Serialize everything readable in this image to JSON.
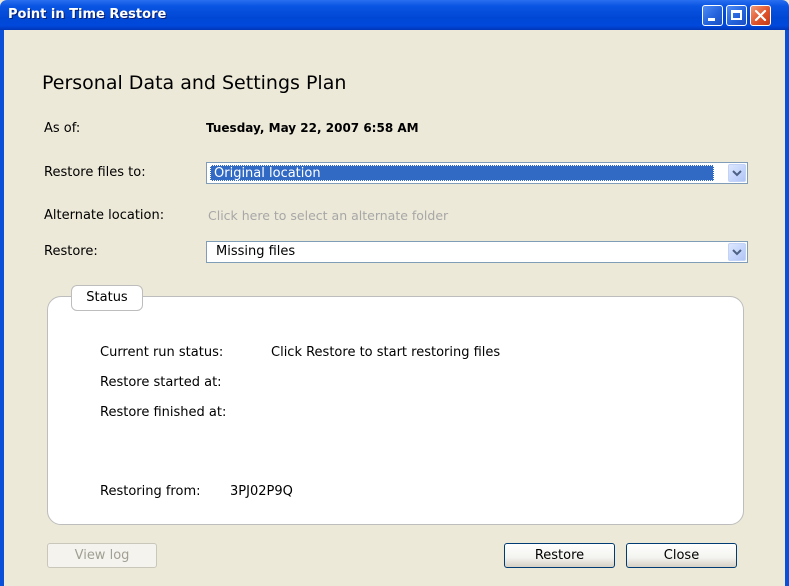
{
  "window": {
    "title": "Point in Time Restore"
  },
  "plan": {
    "heading": "Personal Data and Settings Plan"
  },
  "form": {
    "as_of_label": "As of:",
    "as_of_value": "Tuesday, May 22, 2007 6:58 AM",
    "restore_to_label": "Restore files to:",
    "restore_to_value": "Original location",
    "alternate_label": "Alternate location:",
    "alternate_link": "Click here to select an alternate folder",
    "restore_label": "Restore:",
    "restore_value": "Missing files"
  },
  "status": {
    "tab_label": "Status",
    "current_run_label": "Current run status:",
    "current_run_value": "Click Restore to start restoring files",
    "started_label": "Restore started at:",
    "finished_label": "Restore finished at:",
    "restoring_from_label": "Restoring from:",
    "restoring_from_value": "3PJ02P9Q"
  },
  "buttons": {
    "view_log": "View log",
    "restore": "Restore",
    "close": "Close"
  },
  "colors": {
    "titlebar": "#0a55e3",
    "selection": "#316ac5",
    "window_bg": "#ece9d8",
    "link_disabled": "#a7a7a7"
  }
}
